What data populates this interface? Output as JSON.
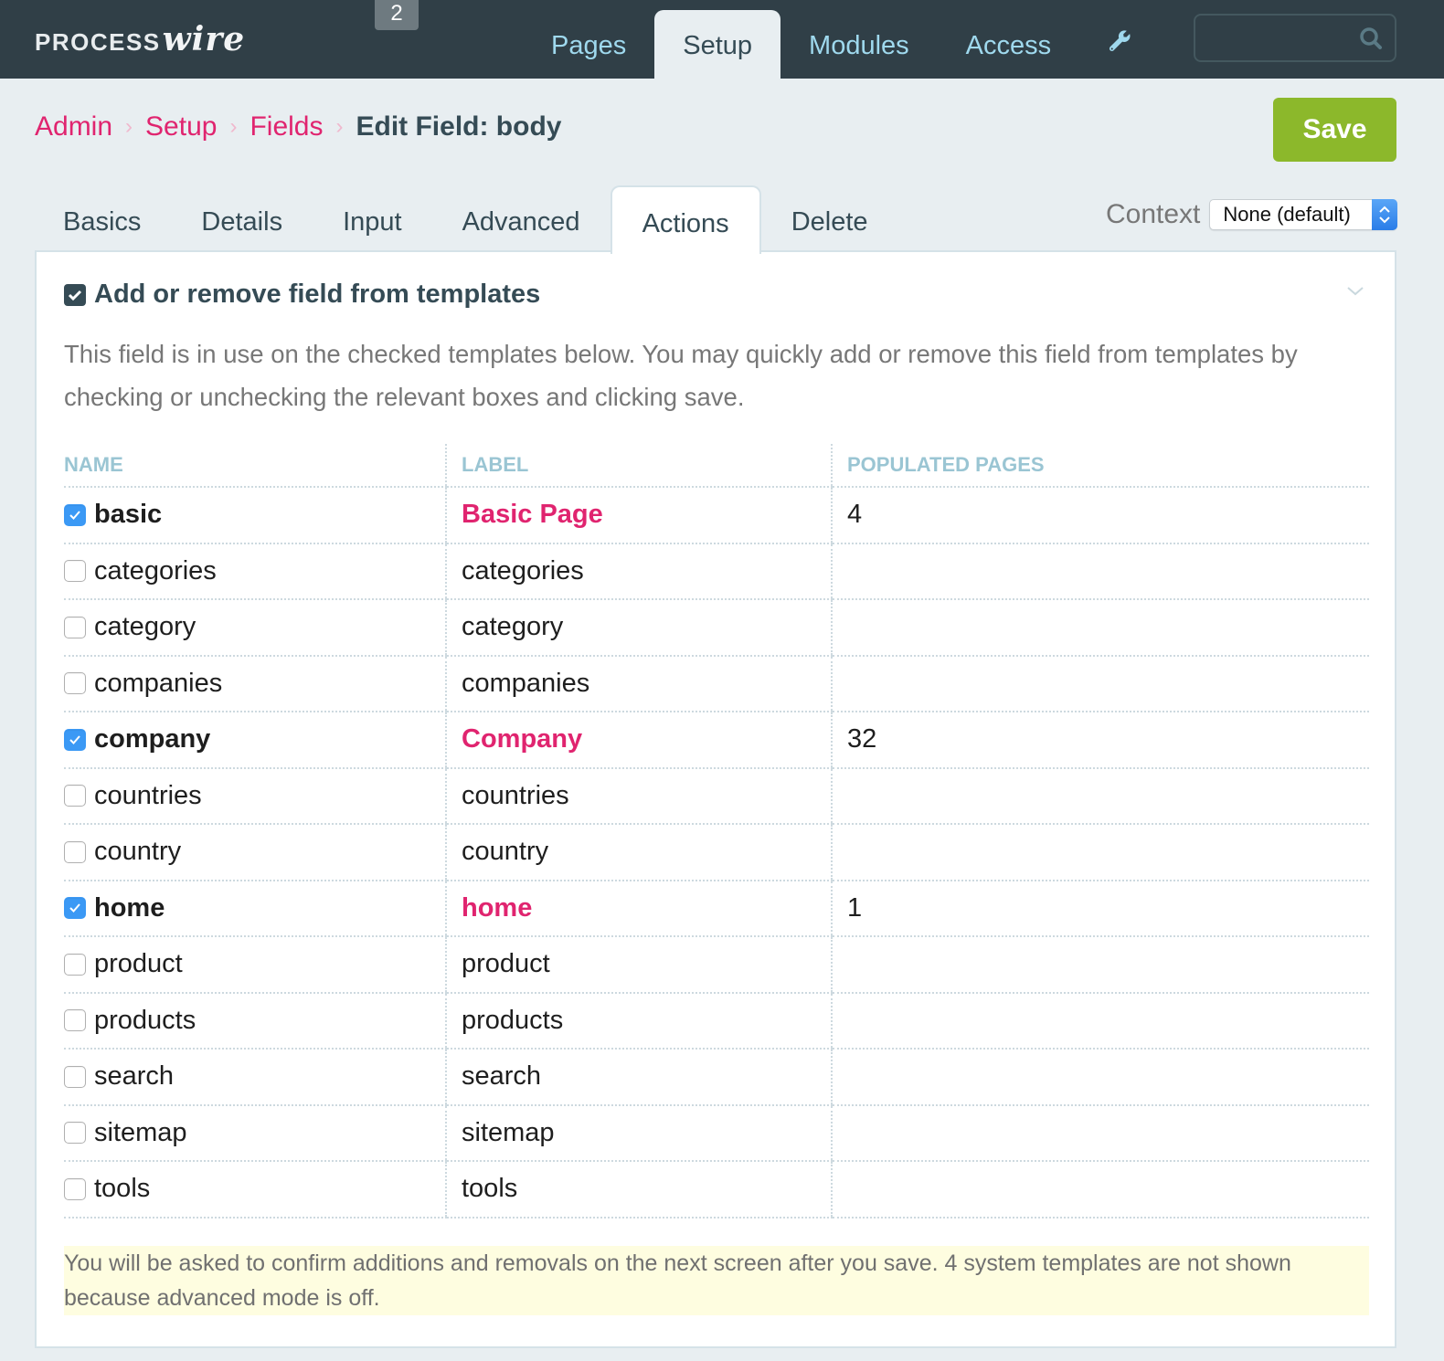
{
  "masthead": {
    "logo_process": "PROCESS",
    "logo_wire": "wire",
    "notice_count": "2",
    "nav": [
      {
        "label": "Pages",
        "active": false
      },
      {
        "label": "Setup",
        "active": true
      },
      {
        "label": "Modules",
        "active": false
      },
      {
        "label": "Access",
        "active": false
      }
    ],
    "tools_icon": "wrench-icon",
    "search": {
      "value": "",
      "placeholder": "",
      "icon": "search-icon"
    }
  },
  "breadcrumb": {
    "items": [
      "Admin",
      "Setup",
      "Fields"
    ],
    "separator": "›",
    "current": "Edit Field: body"
  },
  "toolbar": {
    "save_label": "Save"
  },
  "tabs": [
    {
      "label": "Basics",
      "active": false
    },
    {
      "label": "Details",
      "active": false
    },
    {
      "label": "Input",
      "active": false
    },
    {
      "label": "Advanced",
      "active": false
    },
    {
      "label": "Actions",
      "active": true
    },
    {
      "label": "Delete",
      "active": false
    }
  ],
  "context": {
    "label": "Context",
    "selected": "None (default)"
  },
  "panel": {
    "title": "Add or remove field from templates",
    "description": "This field is in use on the checked templates below. You may quickly add or remove this field from templates by checking or unchecking the relevant boxes and clicking save.",
    "table": {
      "columns": [
        "NAME",
        "LABEL",
        "POPULATED PAGES"
      ],
      "rows": [
        {
          "name": "basic",
          "label": "Basic Page",
          "populated": "4",
          "checked": true
        },
        {
          "name": "categories",
          "label": "categories",
          "populated": "",
          "checked": false
        },
        {
          "name": "category",
          "label": "category",
          "populated": "",
          "checked": false
        },
        {
          "name": "companies",
          "label": "companies",
          "populated": "",
          "checked": false
        },
        {
          "name": "company",
          "label": "Company",
          "populated": "32",
          "checked": true
        },
        {
          "name": "countries",
          "label": "countries",
          "populated": "",
          "checked": false
        },
        {
          "name": "country",
          "label": "country",
          "populated": "",
          "checked": false
        },
        {
          "name": "home",
          "label": "home",
          "populated": "1",
          "checked": true
        },
        {
          "name": "product",
          "label": "product",
          "populated": "",
          "checked": false
        },
        {
          "name": "products",
          "label": "products",
          "populated": "",
          "checked": false
        },
        {
          "name": "search",
          "label": "search",
          "populated": "",
          "checked": false
        },
        {
          "name": "sitemap",
          "label": "sitemap",
          "populated": "",
          "checked": false
        },
        {
          "name": "tools",
          "label": "tools",
          "populated": "",
          "checked": false
        }
      ]
    },
    "notes": "You will be asked to confirm additions and removals on the next screen after you save. 4 system templates are not shown because advanced mode is off."
  },
  "colors": {
    "masthead_bg": "#303f47",
    "nav_link": "#9fd9ee",
    "accent_pink": "#e0246f",
    "save_green": "#8cb82b",
    "checkbox_blue": "#3b99f5",
    "notes_bg": "#fefde0"
  }
}
